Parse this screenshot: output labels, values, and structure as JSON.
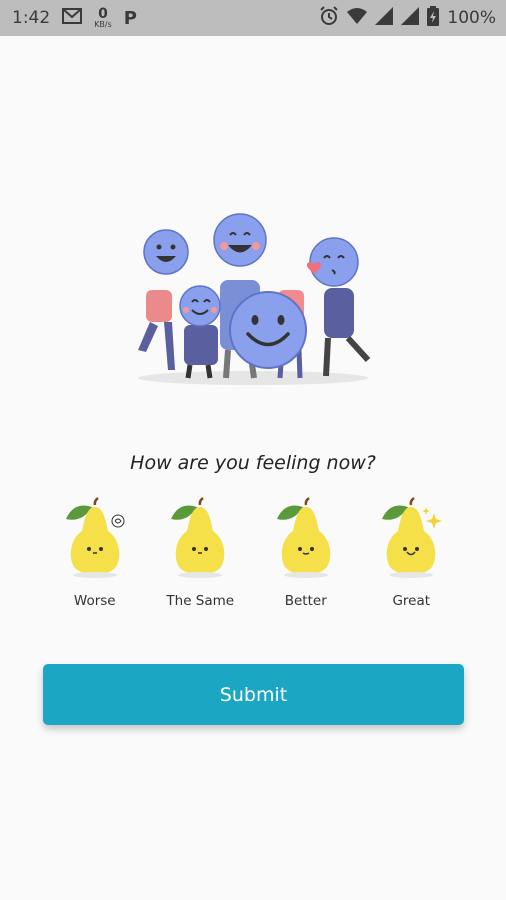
{
  "status_bar": {
    "time": "1:42",
    "data_rate_value": "0",
    "data_rate_unit": "KB/s",
    "battery": "100%"
  },
  "survey": {
    "question": "How are you feeling now?",
    "options": [
      {
        "label": "Worse",
        "icon": "pear-worse-icon"
      },
      {
        "label": "The Same",
        "icon": "pear-same-icon"
      },
      {
        "label": "Better",
        "icon": "pear-better-icon"
      },
      {
        "label": "Great",
        "icon": "pear-great-icon"
      }
    ],
    "submit_label": "Submit"
  },
  "colors": {
    "accent": "#1ba6c3",
    "status_bar": "#bdbdbd",
    "pear": "#f6e04a",
    "leaf": "#5a9a3a"
  }
}
